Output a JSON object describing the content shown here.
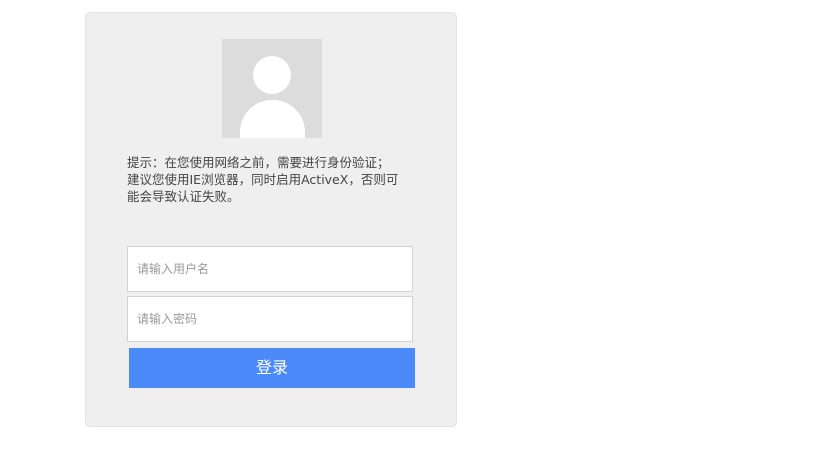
{
  "notice": {
    "lines": [
      "提示：在您使用网络之前，需要进行身份验证；",
      "建议您使用IE浏览器，同时启用ActiveX，否则可",
      "能会导致认证失败。"
    ]
  },
  "form": {
    "username_placeholder": "请输入用户名",
    "username_value": "",
    "password_placeholder": "请输入密码",
    "password_value": "",
    "login_label": "登录"
  },
  "icons": {
    "avatar": "user-avatar-icon"
  },
  "colors": {
    "card_background": "#efefef",
    "avatar_background": "#dcdcdc",
    "button_background": "#4b8af8",
    "button_text": "#ffffff"
  }
}
